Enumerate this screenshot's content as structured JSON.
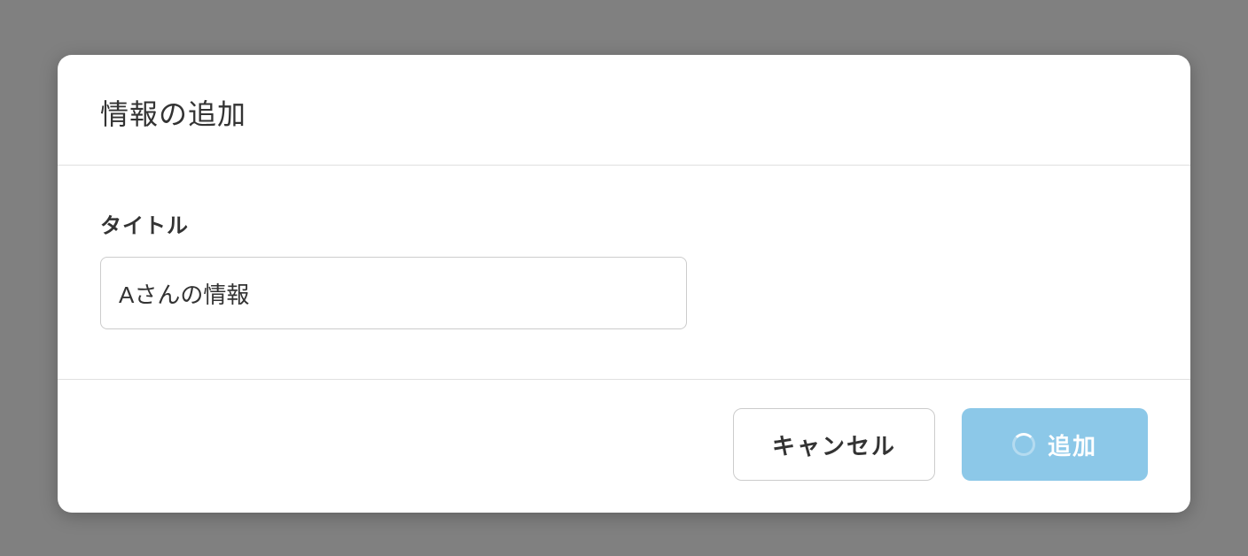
{
  "modal": {
    "title": "情報の追加",
    "field_label": "タイトル",
    "title_value": "Aさんの情報",
    "cancel_label": "キャンセル",
    "submit_label": "追加"
  }
}
